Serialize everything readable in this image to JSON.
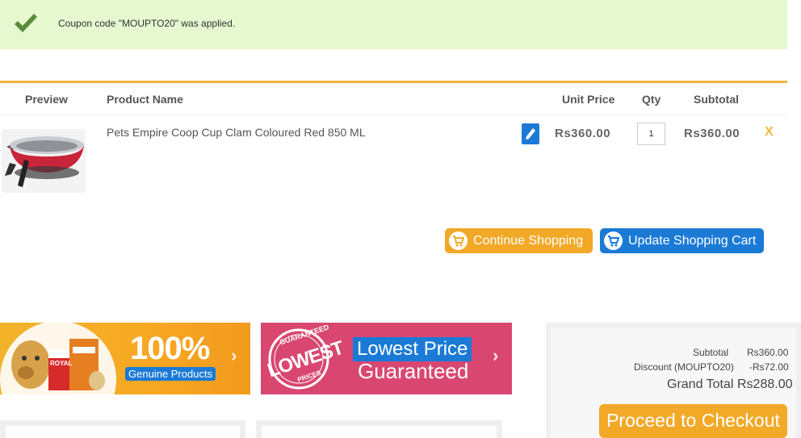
{
  "notice": {
    "icon": "checkmark-icon",
    "message": "Coupon code \"MOUPTO20\" was applied."
  },
  "cart": {
    "columns": {
      "preview": "Preview",
      "product_name": "Product Name",
      "unit_price": "Unit Price",
      "qty": "Qty",
      "subtotal": "Subtotal"
    },
    "items": [
      {
        "name": "Pets Empire Coop Cup Clam Coloured Red 850 ML",
        "unit_price": "Rs360.00",
        "qty": "1",
        "subtotal": "Rs360.00",
        "remove_label": "X",
        "edit_icon": "pencil-icon"
      }
    ],
    "continue_label": "Continue Shopping",
    "update_label": "Update Shopping Cart"
  },
  "banners": {
    "genuine": {
      "big": "100%",
      "tag": "Genuine Products",
      "brand_text": "ROYAL"
    },
    "lowest": {
      "seal_top": "GUARANTEED",
      "seal_main": "LOWEST",
      "seal_bottom": "PRICES",
      "tag": "Lowest Price",
      "sub": "Guaranteed"
    },
    "chevron": "›"
  },
  "totals": {
    "subtotal_label": "Subtotal",
    "subtotal_value": "Rs360.00",
    "discount_label": "Discount (MOUPTO20)",
    "discount_value": "-Rs72.00",
    "grand_label": "Grand Total",
    "grand_value": "Rs288.00",
    "checkout_label": "Proceed to Checkout"
  },
  "colors": {
    "accent_orange": "#f2a928",
    "accent_blue": "#1a7ad6",
    "success_bg": "#e5f8cf",
    "check_green": "#5a8a3a"
  }
}
